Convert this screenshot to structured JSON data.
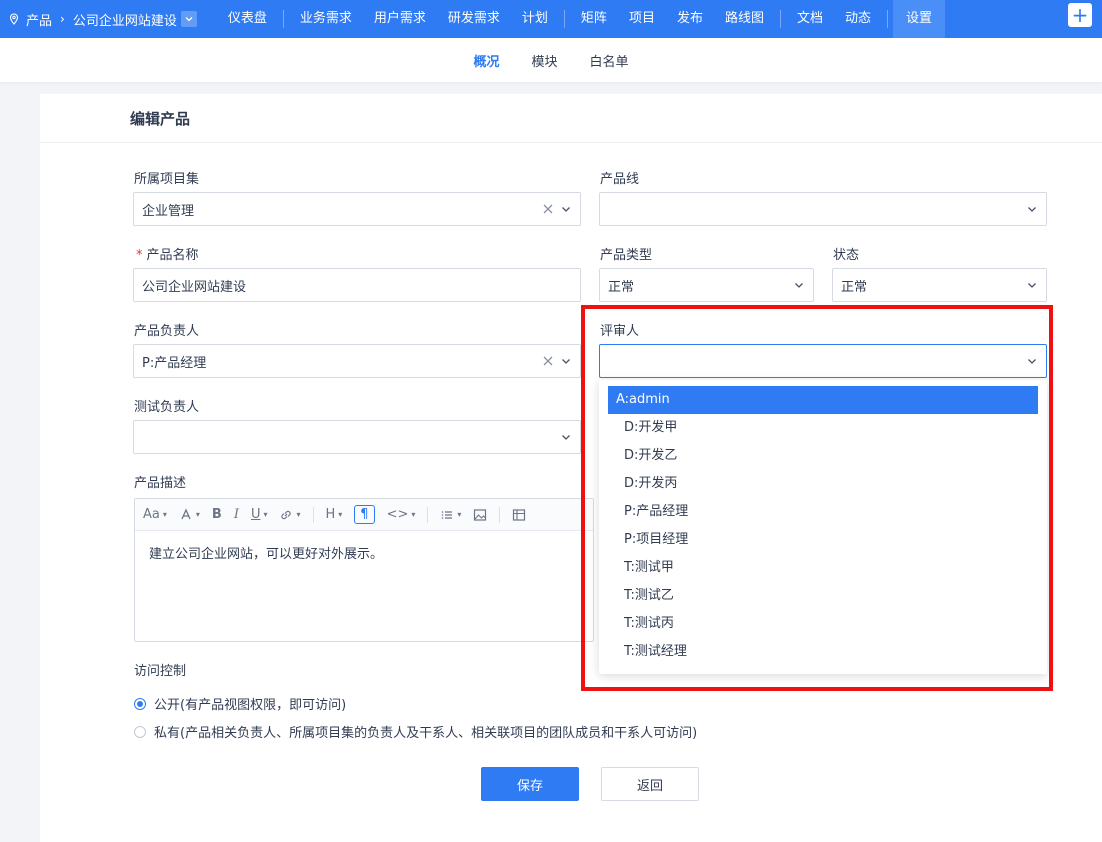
{
  "topbar": {
    "crumb_root": "产品",
    "crumb_product": "公司企业网站建设",
    "nav_group1": [
      "仪表盘"
    ],
    "nav_group2": [
      "业务需求",
      "用户需求",
      "研发需求",
      "计划"
    ],
    "nav_group3": [
      "矩阵",
      "项目",
      "发布",
      "路线图"
    ],
    "nav_group4": [
      "文档",
      "动态"
    ],
    "nav_active": "设置",
    "plus_label": "+"
  },
  "subnav": {
    "tabs": [
      "概况",
      "模块",
      "白名单"
    ],
    "active": "概况"
  },
  "form": {
    "title": "编辑产品",
    "program_label": "所属项目集",
    "program_value": "企业管理",
    "line_label": "产品线",
    "line_value": "",
    "name_label": "产品名称",
    "name_required": "*",
    "name_value": "公司企业网站建设",
    "type_label": "产品类型",
    "type_value": "正常",
    "status_label": "状态",
    "status_value": "正常",
    "owner_label": "产品负责人",
    "owner_value": "P:产品经理",
    "reviewer_label": "评审人",
    "reviewer_value": "",
    "qa_label": "测试负责人",
    "qa_value": "",
    "desc_label": "产品描述",
    "desc_value": "建立公司企业网站，可以更好对外展示。",
    "acl_label": "访问控制",
    "acl_options": [
      "公开(有产品视图权限，即可访问)",
      "私有(产品相关负责人、所属项目集的负责人及干系人、相关联项目的团队成员和干系人可访问)"
    ],
    "acl_selected": "公开(有产品视图权限，即可访问)",
    "save_label": "保存",
    "back_label": "返回"
  },
  "reviewer_dropdown": {
    "options": [
      "A:admin",
      "D:开发甲",
      "D:开发乙",
      "D:开发丙",
      "P:产品经理",
      "P:项目经理",
      "T:测试甲",
      "T:测试乙",
      "T:测试丙",
      "T:测试经理"
    ],
    "highlighted": "A:admin"
  },
  "colors": {
    "brand": "#2e7bf4",
    "annotation": "#ee1111"
  }
}
